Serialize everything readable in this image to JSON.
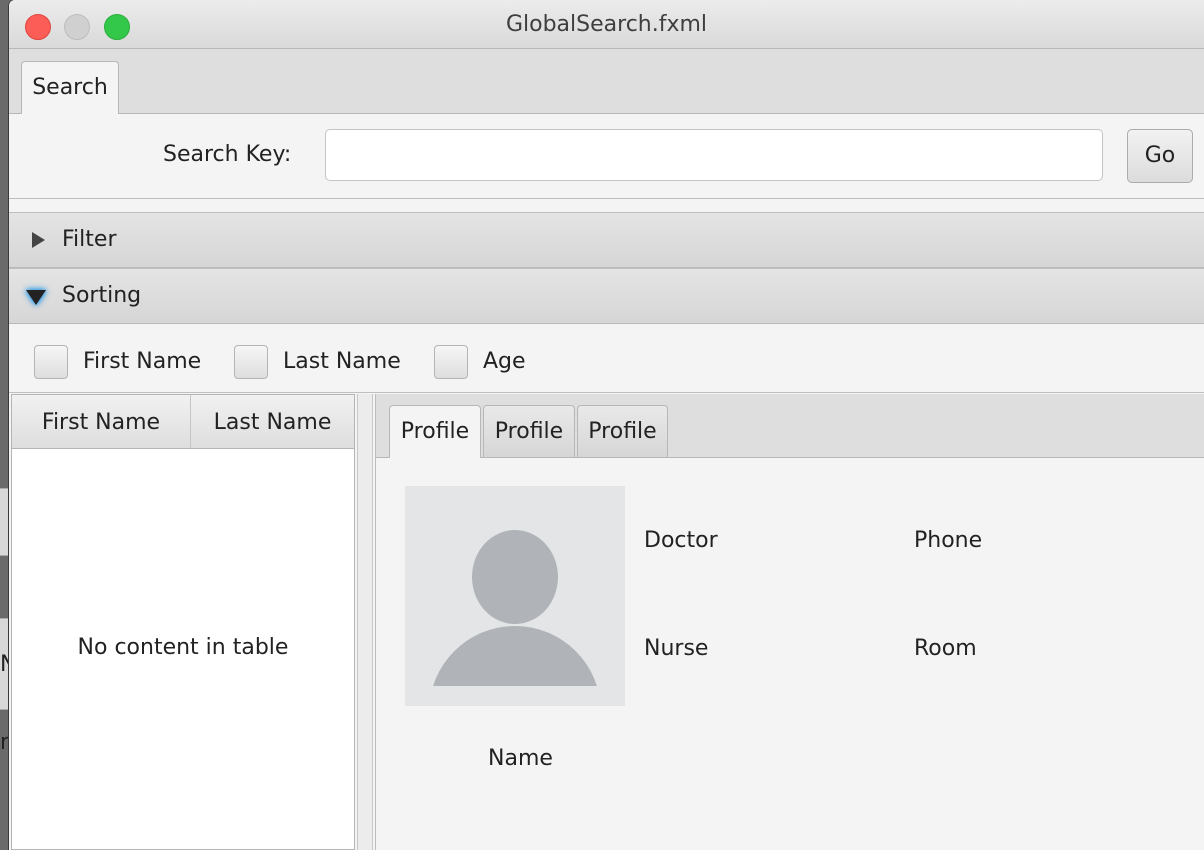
{
  "window": {
    "title": "GlobalSearch.fxml"
  },
  "tabs": {
    "main": [
      "Search"
    ]
  },
  "search": {
    "label": "Search Key:",
    "value": "",
    "placeholder": "",
    "go_label": "Go"
  },
  "panes": {
    "filter": {
      "title": "Filter",
      "expanded": false
    },
    "sorting": {
      "title": "Sorting",
      "expanded": true
    }
  },
  "sorting_options": [
    {
      "label": "First Name",
      "checked": false
    },
    {
      "label": "Last Name",
      "checked": false
    },
    {
      "label": "Age",
      "checked": false
    }
  ],
  "table": {
    "columns": [
      "First Name",
      "Last Name"
    ],
    "rows": [],
    "placeholder": "No content in table"
  },
  "profile_tabs": [
    "Profile",
    "Profile",
    "Profile"
  ],
  "profile": {
    "name_label": "Name",
    "doctor_label": "Doctor",
    "phone_label": "Phone",
    "nurse_label": "Nurse",
    "room_label": "Room"
  },
  "background": {
    "glyph_1": "N",
    "glyph_2": "m"
  },
  "colors": {
    "close": "#fc5d57",
    "maximize": "#34c84a",
    "focus_glow": "#3aa0e8",
    "avatar_bg": "#e4e5e7",
    "avatar_fg": "#b0b4b8"
  },
  "icons": {
    "filter_toggle": "triangle-right-icon",
    "sorting_toggle": "triangle-down-icon",
    "avatar": "user-silhouette-icon"
  }
}
